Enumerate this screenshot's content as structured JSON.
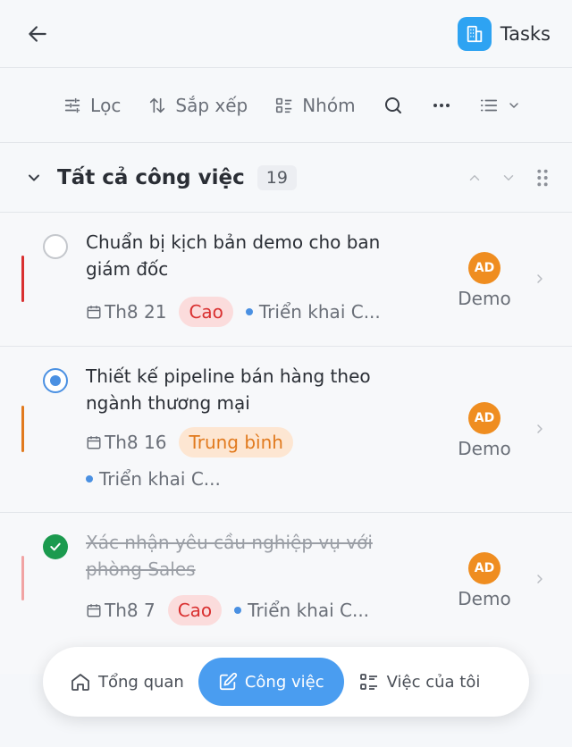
{
  "header": {
    "title": "Tasks",
    "back_icon": "arrow-left-icon",
    "logo_icon": "building-icon",
    "accent": "#2ea3f2"
  },
  "toolbar": {
    "filter": "Lọc",
    "sort": "Sắp xếp",
    "group": "Nhóm"
  },
  "group": {
    "title": "Tất cả công việc",
    "count": "19"
  },
  "tasks": [
    {
      "title": "Chuẩn bị kịch bản demo cho ban giám đốc",
      "status": "todo",
      "date": "Th8 21",
      "priority": "Cao",
      "priority_level": "high",
      "project": "Triển khai C...",
      "assignee_initials": "AD",
      "assignee": "Demo"
    },
    {
      "title": "Thiết kế pipeline bán hàng theo ngành thương mại",
      "status": "in-progress",
      "date": "Th8 16",
      "priority": "Trung bình",
      "priority_level": "medium",
      "project": "Triển khai C...",
      "assignee_initials": "AD",
      "assignee": "Demo"
    },
    {
      "title": "Xác nhận yêu cầu nghiệp vụ với phòng Sales",
      "status": "done",
      "date": "Th8 7",
      "priority": "Cao",
      "priority_level": "high",
      "project": "Triển khai C...",
      "assignee_initials": "AD",
      "assignee": "Demo"
    }
  ],
  "bottom_nav": {
    "overview": "Tổng quan",
    "tasks": "Công việc",
    "my_tasks": "Việc của tôi",
    "active": "tasks"
  },
  "colors": {
    "high": "#d93030",
    "medium": "#e17a1e",
    "done_check": "#1b9a4e",
    "active_nav": "#4a9df0"
  }
}
